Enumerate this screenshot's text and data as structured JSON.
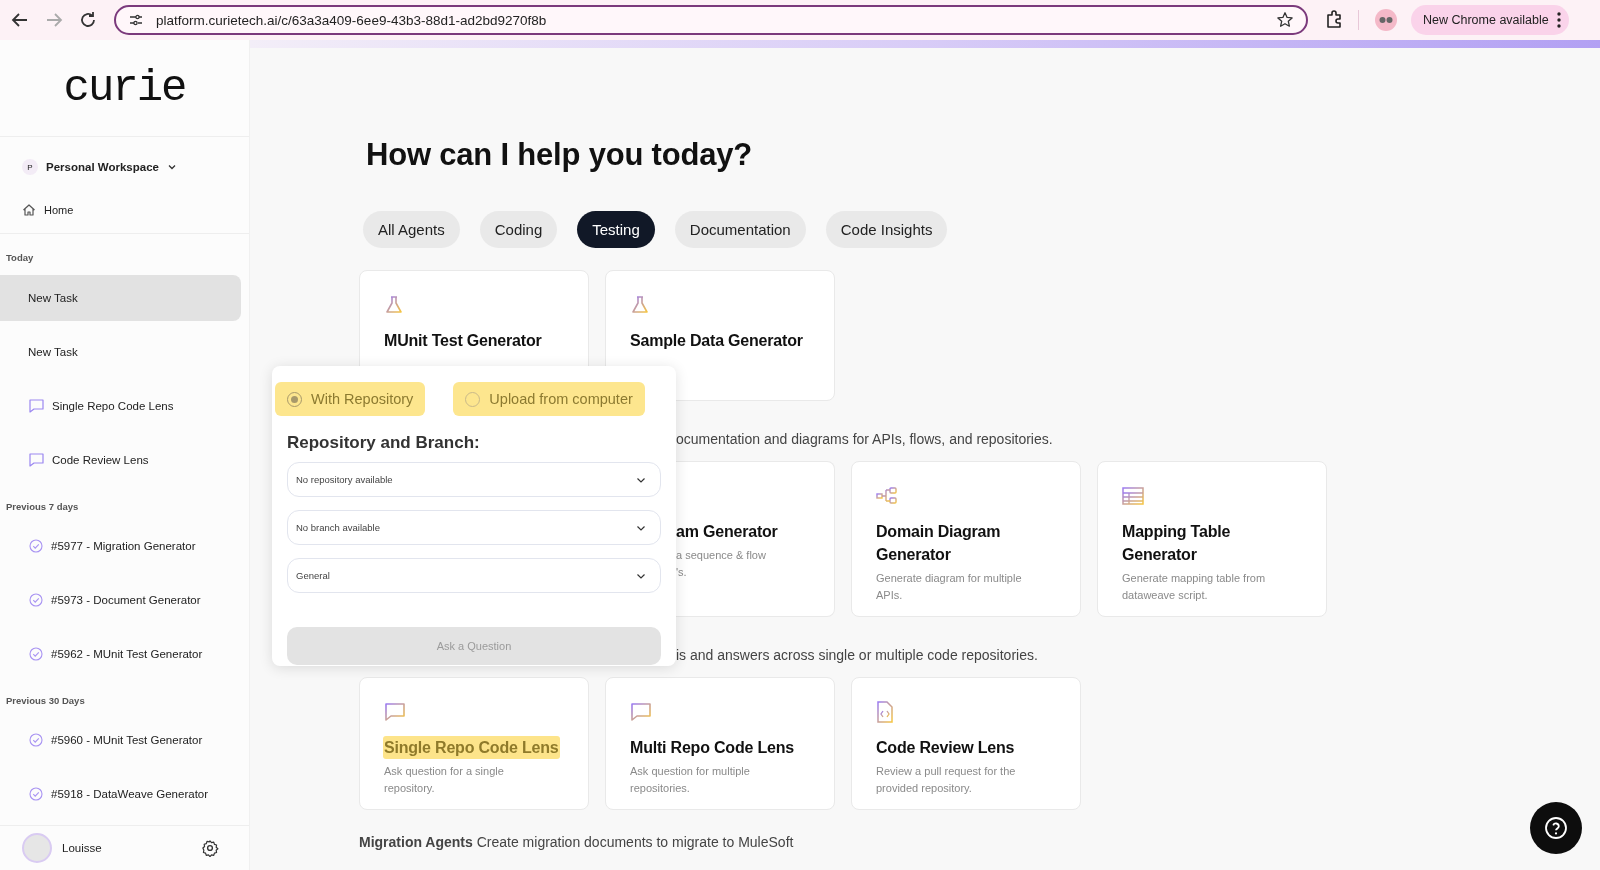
{
  "browser": {
    "url": "platform.curietech.ai/c/63a3a409-6ee9-43b3-88d1-ad2bd9270f8b",
    "update_button": "New Chrome available"
  },
  "sidebar": {
    "logo": "curie",
    "workspace": {
      "badge": "P",
      "name": "Personal Workspace"
    },
    "home": "Home",
    "groups": [
      {
        "title": "Today",
        "items": [
          {
            "label": "New Task",
            "kind": "draft",
            "selected": true
          },
          {
            "label": "New Task",
            "kind": "draft",
            "selected": false
          },
          {
            "label": "Single Repo Code Lens",
            "kind": "chat",
            "selected": false
          },
          {
            "label": "Code Review Lens",
            "kind": "chat",
            "selected": false
          }
        ]
      },
      {
        "title": "Previous 7 days",
        "items": [
          {
            "label": "#5977 - Migration Generator",
            "kind": "done",
            "selected": false
          },
          {
            "label": "#5973 - Document Generator",
            "kind": "done",
            "selected": false
          },
          {
            "label": "#5962 - MUnit Test Generator",
            "kind": "done",
            "selected": false
          }
        ]
      },
      {
        "title": "Previous 30 Days",
        "items": [
          {
            "label": "#5960 - MUnit Test Generator",
            "kind": "done",
            "selected": false
          },
          {
            "label": "#5918 - DataWeave Generator",
            "kind": "done",
            "selected": false
          }
        ]
      }
    ],
    "user": {
      "name": "Louisse"
    }
  },
  "main": {
    "heading": "How can I help you today?",
    "tabs": [
      {
        "label": "All Agents",
        "selected": false
      },
      {
        "label": "Coding",
        "selected": false
      },
      {
        "label": "Testing",
        "selected": true
      },
      {
        "label": "Documentation",
        "selected": false
      },
      {
        "label": "Code Insights",
        "selected": false
      }
    ],
    "sections": [
      {
        "cards": [
          {
            "kind": "testing",
            "title": "MUnit Test Generator",
            "highlighted": false
          },
          {
            "kind": "testing",
            "title": "Sample Data Generator",
            "highlighted": false
          }
        ]
      },
      {
        "partial": true,
        "description": "ocumentation and diagrams for APIs, flows, and repositories.",
        "cards": [
          {
            "kind": "partial",
            "title": "am Generator",
            "description": "a sequence & flow\n's.",
            "highlighted": false
          },
          {
            "kind": "diagram",
            "title": "Domain Diagram Generator",
            "description": "Generate diagram for multiple APIs.",
            "highlighted": false
          },
          {
            "kind": "table",
            "title": "Mapping Table Generator",
            "description": "Generate mapping table from dataweave script.",
            "highlighted": false
          }
        ]
      },
      {
        "partial": true,
        "description": "is and answers across single or multiple code repositories.",
        "cards": [
          {
            "kind": "lens",
            "title": "Single Repo Code Lens",
            "description": "Ask question for a single repository.",
            "highlighted": true
          },
          {
            "kind": "lens",
            "title": "Multi Repo Code Lens",
            "description": "Ask question for multiple repositories.",
            "highlighted": false
          },
          {
            "kind": "review",
            "title": "Code Review Lens",
            "description": "Review a pull request for the provided repository.",
            "highlighted": false
          }
        ]
      },
      {
        "description": "**Migration Agents** Create migration documents to migrate to MuleSoft"
      }
    ]
  },
  "popover": {
    "options": [
      {
        "label": "With Repository",
        "selected": true,
        "highlighted": true
      },
      {
        "label": "Upload from computer",
        "selected": false,
        "highlighted": true
      }
    ],
    "heading": "Repository and Branch:",
    "selects": [
      {
        "value": "No repository available"
      },
      {
        "value": "No branch available"
      },
      {
        "value": "General"
      }
    ],
    "button": {
      "label": "Ask a Question",
      "disabled": true
    }
  }
}
